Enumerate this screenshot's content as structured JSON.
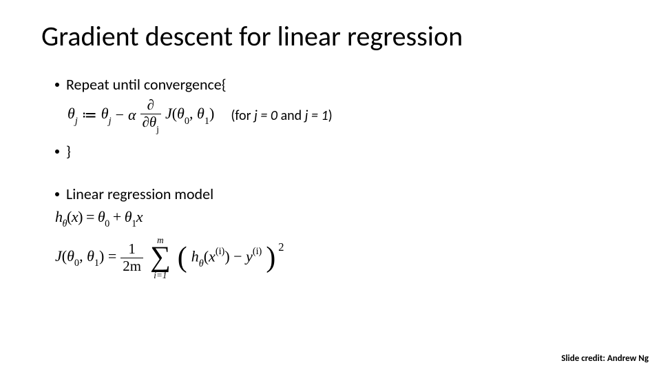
{
  "title": "Gradient descent for linear regression",
  "line_repeat": "Repeat until convergence{",
  "update": {
    "lhs_theta": "θ",
    "lhs_sub": "j",
    "assign": " ≔ ",
    "rhs_theta": "θ",
    "rhs_sub": "j",
    "minus": " − ",
    "alpha": "α ",
    "frac_num": "∂",
    "frac_den_d": "∂θ",
    "frac_den_sub": "j",
    "J": "J",
    "open": "(",
    "t0": "θ",
    "t0s": "0",
    "comma": ", ",
    "t1": "θ",
    "t1s": "1",
    "close": ")"
  },
  "for_note": "(for ",
  "for_j0": "j = 0",
  "for_and": " and ",
  "for_j1": "j = 1",
  "for_close": ")",
  "brace_close": "}",
  "bullet2": "Linear regression model",
  "hline": {
    "h": "h",
    "hsub": "θ",
    "x_open": "(",
    "x": "x",
    "x_close": ") = ",
    "t0": "θ",
    "t0s": "0",
    "plus": " + ",
    "t1": "θ",
    "t1s": "1",
    "x2": "x"
  },
  "jline": {
    "J": "J",
    "open": "(",
    "t0": "θ",
    "t0s": "0",
    "comma": ", ",
    "t1": "θ",
    "t1s": "1",
    "close": ") = ",
    "frac_num": "1",
    "frac_den": "2m",
    "sum_top": "m",
    "sum_sym": "∑",
    "sum_bot": "i=1",
    "big_open": "(",
    "h": "h",
    "hsub": "θ",
    "hx_open": "(",
    "x": "x",
    "xi": "(i)",
    "hx_close": ")",
    "minus": " − ",
    "y": "y",
    "yi": "(i)",
    "big_close": ")",
    "sq": "2"
  },
  "footer": "Slide credit: Andrew Ng"
}
